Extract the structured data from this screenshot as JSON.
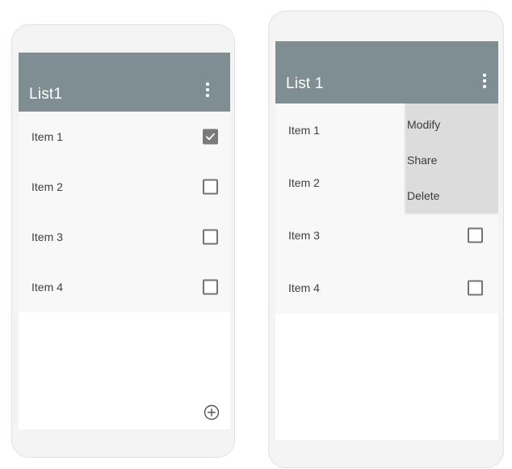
{
  "left_screen": {
    "title": "List1",
    "items": [
      {
        "label": "Item 1",
        "checked": true
      },
      {
        "label": "Item 2",
        "checked": false
      },
      {
        "label": "Item 3",
        "checked": false
      },
      {
        "label": "Item 4",
        "checked": false
      }
    ],
    "add_icon": "plus-circle-icon",
    "menu_icon": "more-vertical-icon"
  },
  "right_screen": {
    "title": "List 1",
    "items": [
      {
        "label": "Item 1"
      },
      {
        "label": "Item 2"
      },
      {
        "label": "Item 3",
        "checked": false
      },
      {
        "label": "Item 4",
        "checked": false
      }
    ],
    "menu_icon": "more-vertical-icon",
    "menu": {
      "items": [
        "Modify",
        "Share",
        "Delete"
      ]
    }
  },
  "colors": {
    "appbar": "#7f8e93",
    "menu_background": "#dcdcdc",
    "list_background": "#f8f8f8"
  }
}
